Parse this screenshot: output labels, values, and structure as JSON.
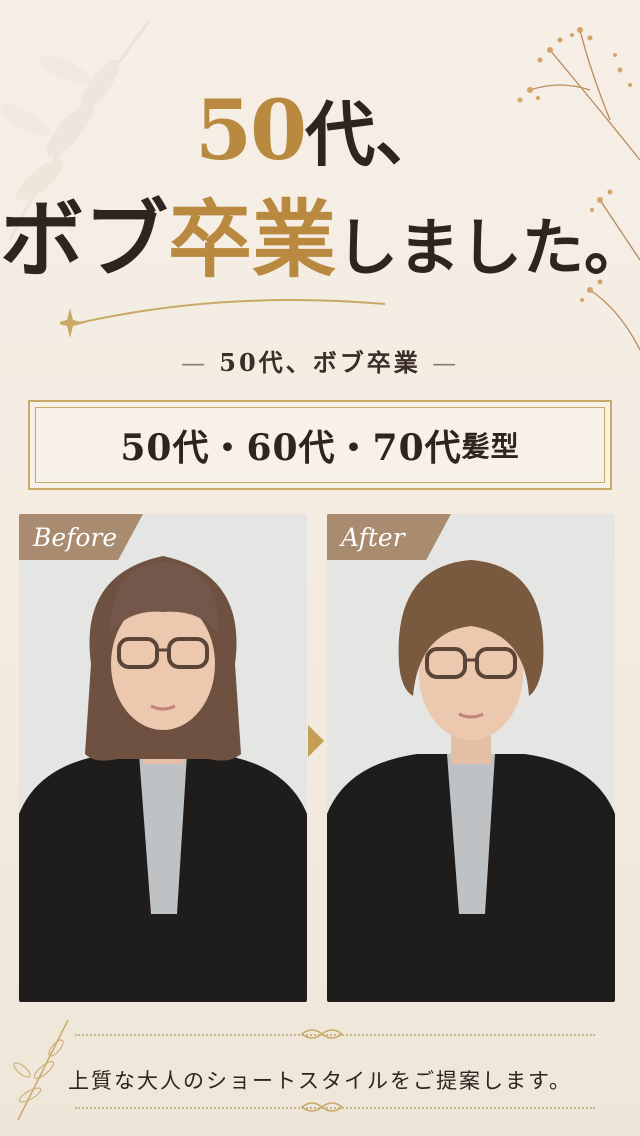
{
  "title": {
    "line1_num": "50",
    "line1_kanji": "代、",
    "line2_a": "ボブ",
    "line2_b": "卒業",
    "line2_c": "しました。"
  },
  "subtitle": {
    "dash_left": "—",
    "text": "50代、ボブ卒業",
    "dash_right": "—"
  },
  "age_box": {
    "main": "50代・60代・70代",
    "suffix": "髪型"
  },
  "photos": {
    "before_label": "Before",
    "after_label": "After"
  },
  "caption": "上質な大人のショートスタイルをご提案します。",
  "colors": {
    "gold": "#b8893f",
    "tag": "#a98c70",
    "background": "#f4ece1"
  }
}
